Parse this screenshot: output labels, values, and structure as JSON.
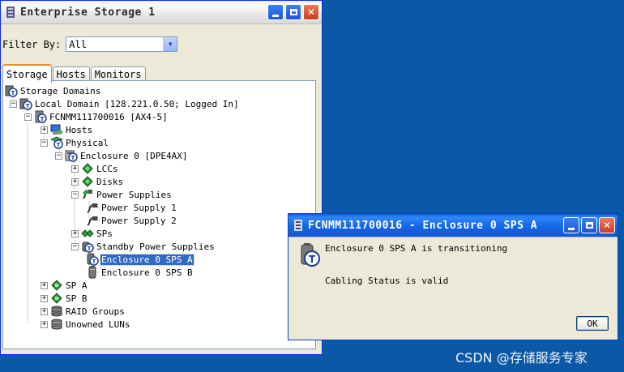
{
  "main_window": {
    "title": "Enterprise Storage 1",
    "filter_label": "Filter By:",
    "filter_value": "All",
    "tabs": [
      {
        "label": "Storage",
        "active": true
      },
      {
        "label": "Hosts",
        "active": false
      },
      {
        "label": "Monitors",
        "active": false
      }
    ],
    "tree": [
      {
        "label": "Storage Domains",
        "expander": "",
        "icon": "storage-domains-icon"
      },
      {
        "label": "Local Domain [128.221.0.50; Logged In]",
        "expander": "−",
        "icon": "domain-icon"
      },
      {
        "label": "FCNMM111700016 [AX4-5]",
        "expander": "−",
        "icon": "storage-system-icon"
      },
      {
        "label": "Hosts",
        "expander": "+",
        "icon": "hosts-icon"
      },
      {
        "label": "Physical",
        "expander": "−",
        "icon": "physical-icon"
      },
      {
        "label": "Enclosure 0 [DPE4AX]",
        "expander": "−",
        "icon": "enclosure-icon"
      },
      {
        "label": "LCCs",
        "expander": "+",
        "icon": "lcc-icon"
      },
      {
        "label": "Disks",
        "expander": "+",
        "icon": "disks-icon"
      },
      {
        "label": "Power Supplies",
        "expander": "−",
        "icon": "power-supplies-icon"
      },
      {
        "label": "Power Supply 1",
        "expander": "",
        "icon": "power-plug-icon"
      },
      {
        "label": "Power Supply 2",
        "expander": "",
        "icon": "power-plug-icon"
      },
      {
        "label": "SPs",
        "expander": "+",
        "icon": "sps-icon"
      },
      {
        "label": "Standby Power Supplies",
        "expander": "−",
        "icon": "standby-power-icon"
      },
      {
        "label": "Enclosure 0 SPS A",
        "expander": "",
        "icon": "sps-battery-transition-icon",
        "selected": true
      },
      {
        "label": "Enclosure 0 SPS B",
        "expander": "",
        "icon": "sps-battery-icon"
      },
      {
        "label": "SP A",
        "expander": "+",
        "icon": "sp-icon"
      },
      {
        "label": "SP B",
        "expander": "+",
        "icon": "sp-icon"
      },
      {
        "label": "RAID Groups",
        "expander": "+",
        "icon": "raid-groups-icon"
      },
      {
        "label": "Unowned LUNs",
        "expander": "+",
        "icon": "luns-icon"
      }
    ]
  },
  "dialog": {
    "title": "FCNMM111700016 - Enclosure 0 SPS A",
    "message_line1": "Enclosure 0 SPS A is transitioning",
    "message_line2": "Cabling Status is valid",
    "ok_label": "OK"
  },
  "watermark": "CSDN @存储服务专家",
  "colors": {
    "desktop": "#0a58a6",
    "selection": "#316ac5",
    "title_active": "#1566e8"
  }
}
